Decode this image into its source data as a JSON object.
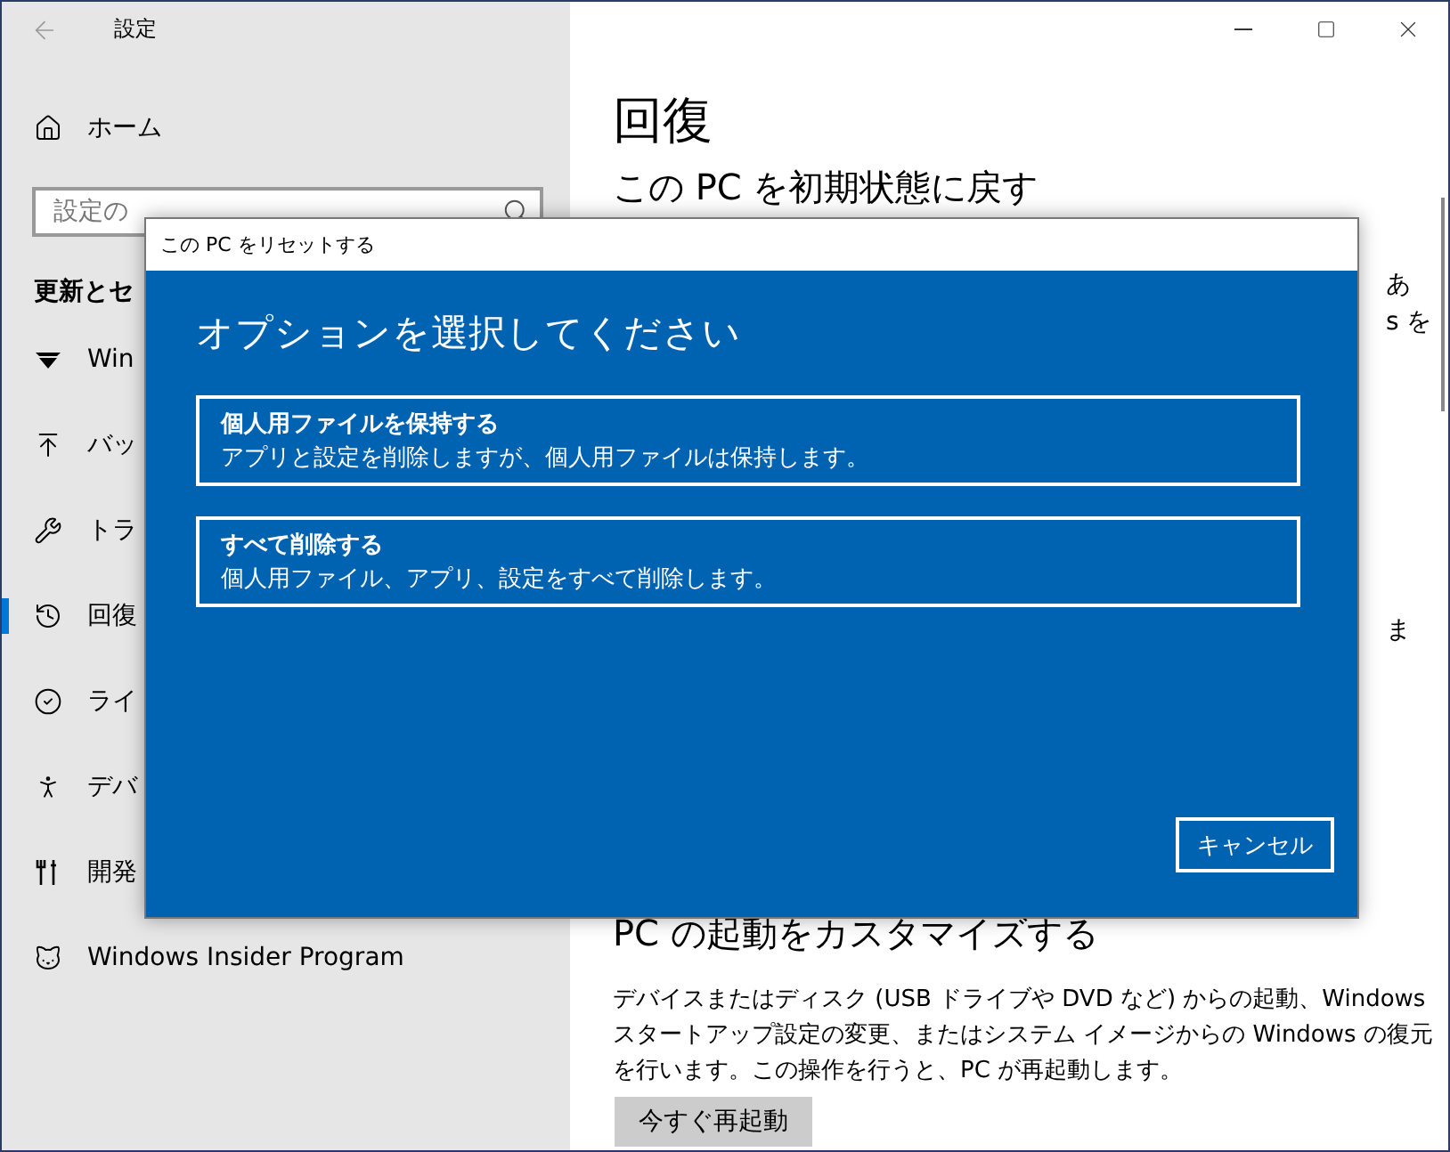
{
  "window": {
    "title": "設定"
  },
  "sidebar": {
    "home": "ホーム",
    "search": {
      "placeholder": "設定の"
    },
    "section": "更新とセ",
    "items": [
      {
        "label": "Win",
        "selected": false
      },
      {
        "label": "バッ",
        "selected": false
      },
      {
        "label": "トラ",
        "selected": false
      },
      {
        "label": "回復",
        "selected": true
      },
      {
        "label": "ライ",
        "selected": false
      },
      {
        "label": "デバ",
        "selected": false
      },
      {
        "label": "開発",
        "selected": false
      },
      {
        "label": "Windows Insider Program",
        "selected": false
      }
    ]
  },
  "content": {
    "title": "回復",
    "reset_heading": "この PC を初期状態に戻す",
    "reset_paragraph_ends": [
      "あ",
      "s を"
    ],
    "advanced_paragraph_ends": [
      "ま"
    ],
    "startup_heading": "PC の起動をカスタマイズする",
    "startup_text": "デバイスまたはディスク (USB ドライブや DVD など) からの起動、Windows スタートアップ設定の変更、またはシステム イメージからの Windows の復元を行います。この操作を行うと、PC が再起動します。",
    "restart_button": "今すぐ再起動"
  },
  "dialog": {
    "title": "この PC をリセットする",
    "heading": "オプションを選択してください",
    "options": [
      {
        "title": "個人用ファイルを保持する",
        "description": "アプリと設定を削除しますが、個人用ファイルは保持します。"
      },
      {
        "title": "すべて削除する",
        "description": "個人用ファイル、アプリ、設定をすべて削除します。"
      }
    ],
    "cancel": "キャンセル"
  }
}
